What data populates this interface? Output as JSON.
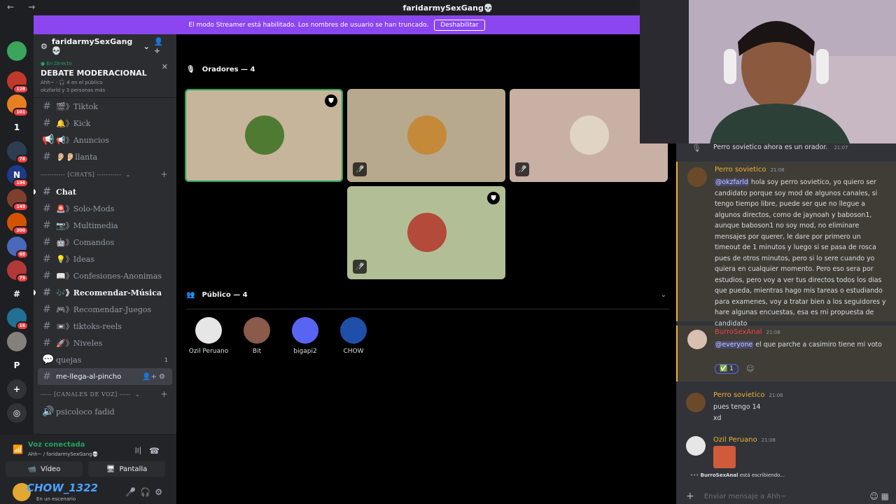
{
  "titlebar": {
    "title": "faridarmySexGang💀",
    "nav": "← →"
  },
  "streamer": {
    "text": "El modo Streamer está habilitado. Los nombres de usuario se han truncado.",
    "button": "Deshabilitar"
  },
  "rail": {
    "items": [
      {
        "label": "",
        "badge": "",
        "color": "#1e1f22",
        "icon": "discord-icon"
      },
      {
        "label": "",
        "badge": "",
        "color": "#3ba55c"
      },
      {
        "label": "",
        "badge": "128",
        "color": "#c0392b"
      },
      {
        "label": "",
        "badge": "101",
        "color": "#e67e22"
      },
      {
        "label": "1",
        "badge": "",
        "color": "#1e1f22"
      },
      {
        "label": "",
        "badge": "78",
        "color": "#2c3e50"
      },
      {
        "label": "N",
        "badge": "196",
        "color": "#1e3a8a"
      },
      {
        "label": "",
        "badge": "149",
        "color": "#7f3f2f"
      },
      {
        "label": "",
        "badge": "200",
        "color": "#d35400"
      },
      {
        "label": "",
        "badge": "68",
        "color": "#4a69bd"
      },
      {
        "label": "",
        "badge": "79",
        "color": "#b33939"
      },
      {
        "label": "#",
        "badge": "",
        "color": "#1e1f22"
      },
      {
        "label": "",
        "badge": "16",
        "color": "#227093"
      },
      {
        "label": "",
        "badge": "",
        "color": "#84817a"
      },
      {
        "label": "P",
        "badge": "",
        "color": "#1e1f22"
      },
      {
        "label": "+",
        "badge": "",
        "color": "#313338"
      },
      {
        "label": "◎",
        "badge": "",
        "color": "#313338"
      }
    ]
  },
  "sidebar": {
    "server_name": "faridarmySexGang💀",
    "live": {
      "tag": "● En Directo",
      "title": "DEBATE MODERACIONAL",
      "audience": "Ahh~ · 🎧 4 en el público",
      "speakers": "okzfarld y 3 personas más"
    },
    "channels_top": [
      {
        "name": "🎬》Tiktok",
        "type": "text"
      },
      {
        "name": "🔔》Kick",
        "type": "text"
      },
      {
        "name": "📢》Anuncios",
        "type": "announce"
      },
      {
        "name": "👂🏻👂🏻llanta",
        "type": "text"
      }
    ],
    "cat_chats": "----------- [CHATS] -----------",
    "channels_chats": [
      {
        "name": "Chat",
        "state": "unread"
      },
      {
        "name": "🚨》Solo-Mods",
        "state": ""
      },
      {
        "name": "📷》Multimedia",
        "state": ""
      },
      {
        "name": "🤖》Comandos",
        "state": ""
      },
      {
        "name": "💡》Ideas",
        "state": ""
      },
      {
        "name": "📖》Confesiones-Anonimas",
        "state": ""
      },
      {
        "name": "🎶》Recomendar-Música",
        "state": "unread"
      },
      {
        "name": "🎮》Recomendar-Juegos",
        "state": ""
      },
      {
        "name": "📼》tiktoks-reels",
        "state": ""
      },
      {
        "name": "🚀》Niveles",
        "state": ""
      }
    ],
    "quejas": {
      "name": "quejas",
      "count": "1"
    },
    "active_channel": "me-llega-al-pincho",
    "cat_voice": "----- [CANALES DE VOZ] -----",
    "voice_channel": "psicoloco fadid"
  },
  "voice": {
    "title": "Voz conectada",
    "sub": "Ahh~ / faridarmySexGang💀",
    "video": "Vídeo",
    "screen": "Pantalla"
  },
  "user": {
    "name": "CHOW_1322",
    "status": "En un escenario"
  },
  "stage": {
    "speakers_title": "Oradores — 4",
    "audience_title": "Público — 4",
    "speakers": [
      {
        "bg": "#c6b59a",
        "avatar": "#4f7a32",
        "mod": true,
        "muted": false,
        "active": true
      },
      {
        "bg": "#b7a98d",
        "avatar": "#c48a3a",
        "mod": false,
        "muted": true,
        "active": false
      },
      {
        "bg": "#c9b0a5",
        "avatar": "#e0d4c4",
        "mod": false,
        "muted": true,
        "active": false
      },
      {
        "bg": "#b2bf96",
        "avatar": "#b44a3a",
        "mod": true,
        "muted": true,
        "active": false
      }
    ],
    "audience": [
      {
        "name": "Ozil Peruano",
        "color": "#e6e6e6"
      },
      {
        "name": "Bit",
        "color": "#8a5a4a"
      },
      {
        "name": "bigapi2",
        "color": "#5865f2"
      },
      {
        "name": "CHOW",
        "color": "#1f4fa8"
      }
    ]
  },
  "chat": {
    "system": {
      "text": "Perro sovietico ahora es un orador.",
      "time": "21:07"
    },
    "messages": [
      {
        "author": "Perro sovietico",
        "time": "21:08",
        "color": "#f0b232",
        "mention": "@okzfarld",
        "text": " hola soy perro sovietico, yo quiero ser candidato porque soy mod de algunos canales, si tengo tiempo libre, puede ser que no llegue a algunos directos, como de jaynoah y baboson1, aunque baboson1 no soy mod, no eliminare mensajes por querer, le dare por primero un timeout de 1 minutos y luego si se pasa de rosca pues de otros minutos, pero si lo sere cuando yo quiera en cualquier momento. Pero eso sera por estudios, pero voy a ver tus directos todos los dias que pueda, mientras hago mis tareas o estudiando para examenes, voy a tratar bien a los seguidores y hare algunas encuestas, esa es mi propuesta de candidato"
      },
      {
        "author": "BurroSexAnal",
        "time": "21:08",
        "color": "#f23f43",
        "mention": "@everyone",
        "text": " el que parche a casimiro tiene mi voto",
        "reaction": "✅ 1"
      },
      {
        "author": "Perro sovietico",
        "time": "21:08",
        "color": "#f0b232",
        "line1": "pues tengo 14",
        "line2": "xd"
      },
      {
        "author": "Ozil Peruano",
        "time": "21:08",
        "color": "#f0b232"
      }
    ],
    "typing_name": "BurroSexAnal",
    "typing_text": " está escribiendo...",
    "input_placeholder": "Enviar mensaje a Ahh~"
  }
}
